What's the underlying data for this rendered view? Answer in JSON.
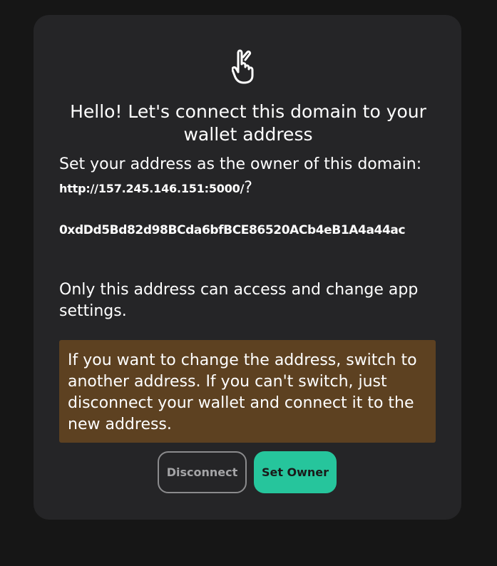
{
  "modal": {
    "icon": "raised-hand-icon",
    "title": "Hello! Let's connect this domain to your wallet address",
    "intro_before": "Set your address as the owner of this domain: ",
    "domain": "http://157.245.146.151:5000/",
    "intro_after": "?",
    "address": "0xdDd5Bd82d98BCda6bfBCE86520ACb4eB1A4a44ac",
    "only_text": "Only this address can access and change app settings.",
    "notice": "If you want to change the address, switch to another address. If you can't switch, just disconnect your wallet and connect it to the new address.",
    "disconnect_label": "Disconnect",
    "set_owner_label": "Set Owner"
  },
  "colors": {
    "background": "#161616",
    "panel": "#252527",
    "notice_bg": "#5d4121",
    "accent": "#26c59c"
  }
}
